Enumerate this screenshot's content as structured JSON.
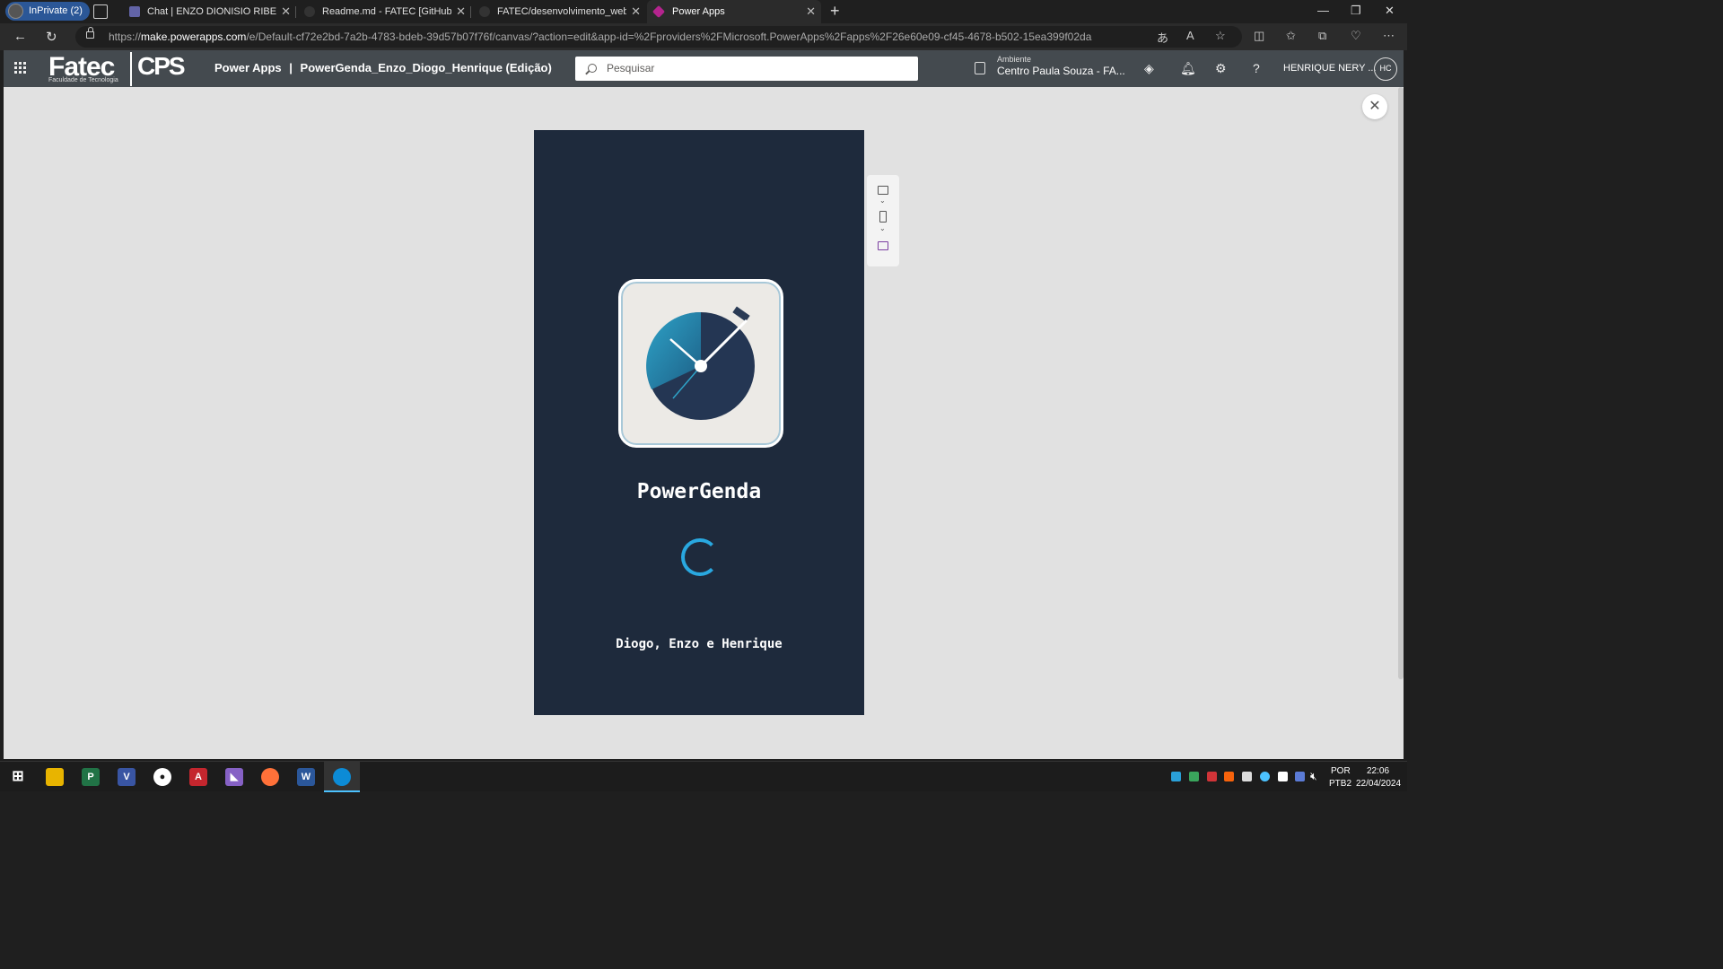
{
  "browser": {
    "inprivate_label": "InPrivate (2)",
    "tabs": [
      {
        "label": "Chat | ENZO DIONISIO RIBEIRO LI",
        "favicon": "teams-icon"
      },
      {
        "label": "Readme.md - FATEC [GitHub] - Vi",
        "favicon": "github-icon"
      },
      {
        "label": "FATEC/desenvolvimento_web/Po",
        "favicon": "github-icon"
      },
      {
        "label": "Power Apps",
        "favicon": "powerapps-icon",
        "active": true
      }
    ],
    "url_prefix": "https://",
    "url_host": "make.powerapps.com",
    "url_path": "/e/Default-cf72e2bd-7a2b-4783-bdeb-39d57b07f76f/canvas/?action=edit&app-id=%2Fproviders%2FMicrosoft.PowerApps%2Fapps%2F26e60e09-cf45-4678-b502-15ea399f02da"
  },
  "header": {
    "logo_text": "Fatec",
    "logo_subtext": "Faculdade de Tecnologia",
    "cps_text": "CPS",
    "product": "Power Apps",
    "separator": "|",
    "app_title": "PowerGenda_Enzo_Diogo_Henrique (Edição)",
    "search_placeholder": "Pesquisar",
    "env_label": "Ambiente",
    "env_name": "Centro Paula Souza - FA...",
    "user_name": "HENRIQUE NERY ...",
    "user_initials": "HC"
  },
  "app": {
    "name": "PowerGenda",
    "authors": "Diogo, Enzo e Henrique"
  },
  "taskbar": {
    "lang_top": "POR",
    "lang_bottom": "PTB2",
    "time": "22:06",
    "date": "22/04/2024"
  },
  "colors": {
    "app_bg": "#1e2a3c",
    "spinner": "#29a8e0",
    "canvas_bg": "#e1e1e1",
    "header_bg": "#444a4f"
  }
}
